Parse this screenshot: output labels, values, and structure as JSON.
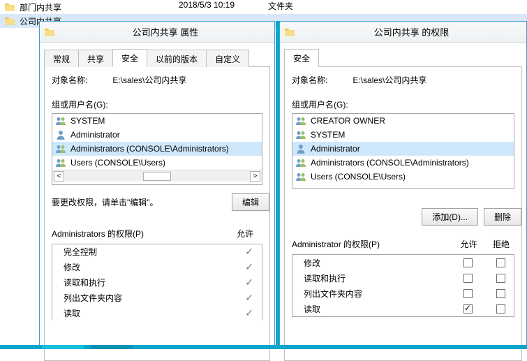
{
  "explorer": {
    "rows": [
      {
        "name": "部门内共享",
        "date": "2018/5/3 10:19",
        "type": "文件夹"
      },
      {
        "name": "公司内共享",
        "date": "",
        "type": ""
      }
    ]
  },
  "leftDialog": {
    "title": "公司内共享 属性",
    "tabs": [
      "常规",
      "共享",
      "安全",
      "以前的版本",
      "自定义"
    ],
    "activeTab": 2,
    "objectLabel": "对象名称:",
    "objectPath": "E:\\sales\\公司内共享",
    "groupLabel": "组或用户名(G):",
    "principals": [
      {
        "name": "SYSTEM",
        "icon": "group"
      },
      {
        "name": "Administrator",
        "icon": "user"
      },
      {
        "name": "Administrators (CONSOLE\\Administrators)",
        "icon": "group",
        "selected": true
      },
      {
        "name": "Users (CONSOLE\\Users)",
        "icon": "group"
      }
    ],
    "editHint": "要更改权限，请单击\"编辑\"。",
    "editBtn": "编辑",
    "permHeaderUser": "Administrators 的权限(P)",
    "permAllow": "允许",
    "perms": [
      {
        "name": "完全控制"
      },
      {
        "name": "修改"
      },
      {
        "name": "读取和执行"
      },
      {
        "name": "列出文件夹内容"
      },
      {
        "name": "读取"
      }
    ]
  },
  "rightDialog": {
    "title": "公司内共享 的权限",
    "tabs": [
      "安全"
    ],
    "objectLabel": "对象名称:",
    "objectPath": "E:\\sales\\公司内共享",
    "groupLabel": "组或用户名(G):",
    "principals": [
      {
        "name": "CREATOR OWNER",
        "icon": "group"
      },
      {
        "name": "SYSTEM",
        "icon": "group"
      },
      {
        "name": "Administrator",
        "icon": "user",
        "selected": true
      },
      {
        "name": "Administrators (CONSOLE\\Administrators)",
        "icon": "group"
      },
      {
        "name": "Users (CONSOLE\\Users)",
        "icon": "group"
      }
    ],
    "addBtn": "添加(D)...",
    "removeBtn": "删除",
    "permHeaderUser": "Administrator 的权限(P)",
    "permAllow": "允许",
    "permDeny": "拒绝",
    "perms": [
      {
        "name": "修改",
        "allow": false,
        "deny": false
      },
      {
        "name": "读取和执行",
        "allow": false,
        "deny": false
      },
      {
        "name": "列出文件夹内容",
        "allow": false,
        "deny": false
      },
      {
        "name": "读取",
        "allow": true,
        "deny": false
      }
    ]
  }
}
